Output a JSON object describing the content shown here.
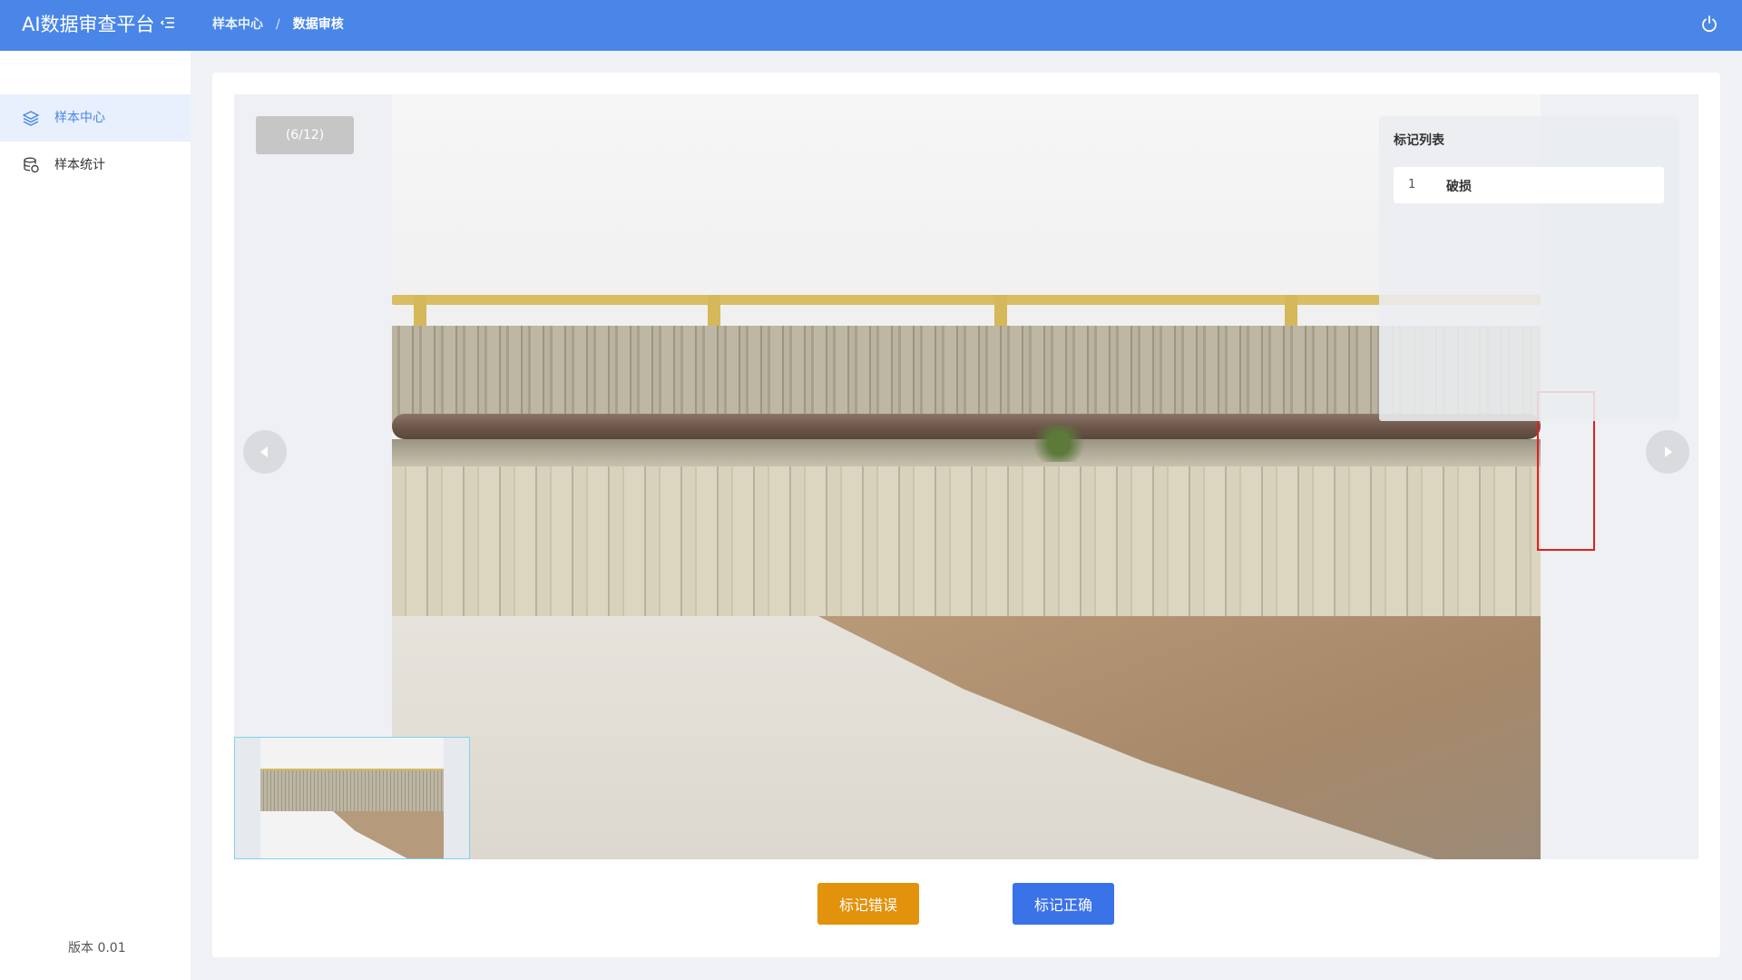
{
  "header": {
    "app_title": "AI数据审查平台",
    "breadcrumb": [
      "样本中心",
      "数据审核"
    ],
    "breadcrumb_separator": "/"
  },
  "sidebar": {
    "items": [
      {
        "label": "样本中心",
        "icon": "layers-icon",
        "active": true
      },
      {
        "label": "样本统计",
        "icon": "database-icon",
        "active": false
      }
    ],
    "version": "版本  0.01"
  },
  "viewer": {
    "counter": "(6/12)",
    "mark_panel": {
      "title": "标记列表",
      "items": [
        {
          "index": "1",
          "label": "破损"
        }
      ]
    }
  },
  "actions": {
    "mark_wrong": "标记错误",
    "mark_correct": "标记正确"
  },
  "colors": {
    "header_bg": "#4a86e8",
    "active_nav_bg": "#e8f0fd",
    "mark_wrong_bg": "#e2920b",
    "mark_correct_bg": "#3a72e8",
    "annotation_box": "#e02020"
  }
}
